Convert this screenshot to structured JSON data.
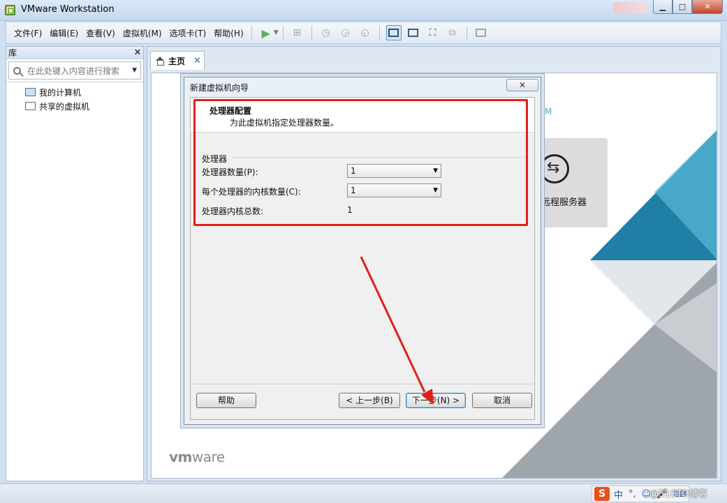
{
  "window": {
    "title": "VMware Workstation"
  },
  "menu": {
    "file": "文件(F)",
    "edit": "编辑(E)",
    "view": "查看(V)",
    "vm": "虚拟机(M)",
    "tabs": "选项卡(T)",
    "help": "帮助(H)"
  },
  "library": {
    "title": "库",
    "search_placeholder": "在此处键入内容进行搜索",
    "items": [
      {
        "label": "我的计算机",
        "icon": "computer-icon"
      },
      {
        "label": "共享的虚拟机",
        "icon": "shared-vm-icon"
      }
    ]
  },
  "home_tab": {
    "label": "主页"
  },
  "home_page": {
    "brand_fragment": "M",
    "remote_server_label": "远程服务器",
    "logo_vm": "vm",
    "logo_ware": "ware"
  },
  "dialog": {
    "title": "新建虚拟机向导",
    "close_label": "✕",
    "header_title": "处理器配置",
    "header_subtitle": "为此虚拟机指定处理器数量。",
    "group_label": "处理器",
    "processor_count_label": "处理器数量(P):",
    "processor_count_value": "1",
    "cores_per_processor_label": "每个处理器的内核数量(C):",
    "cores_per_processor_value": "1",
    "total_cores_label": "处理器内核总数:",
    "total_cores_value": "1",
    "help_button": "帮助",
    "back_button": "< 上一步(B)",
    "next_button": "下一步(N) >",
    "cancel_button": "取消"
  },
  "taskbar": {
    "ime_logo": "S",
    "ime_mode": "中",
    "ime_punct": "°,",
    "watermark": "@51CTO博客"
  },
  "colors": {
    "highlight": "#e0201a",
    "annotation_arrow": "#e0201a",
    "brand_teal": "#1f7fa6",
    "play_green": "#5ab45a"
  }
}
